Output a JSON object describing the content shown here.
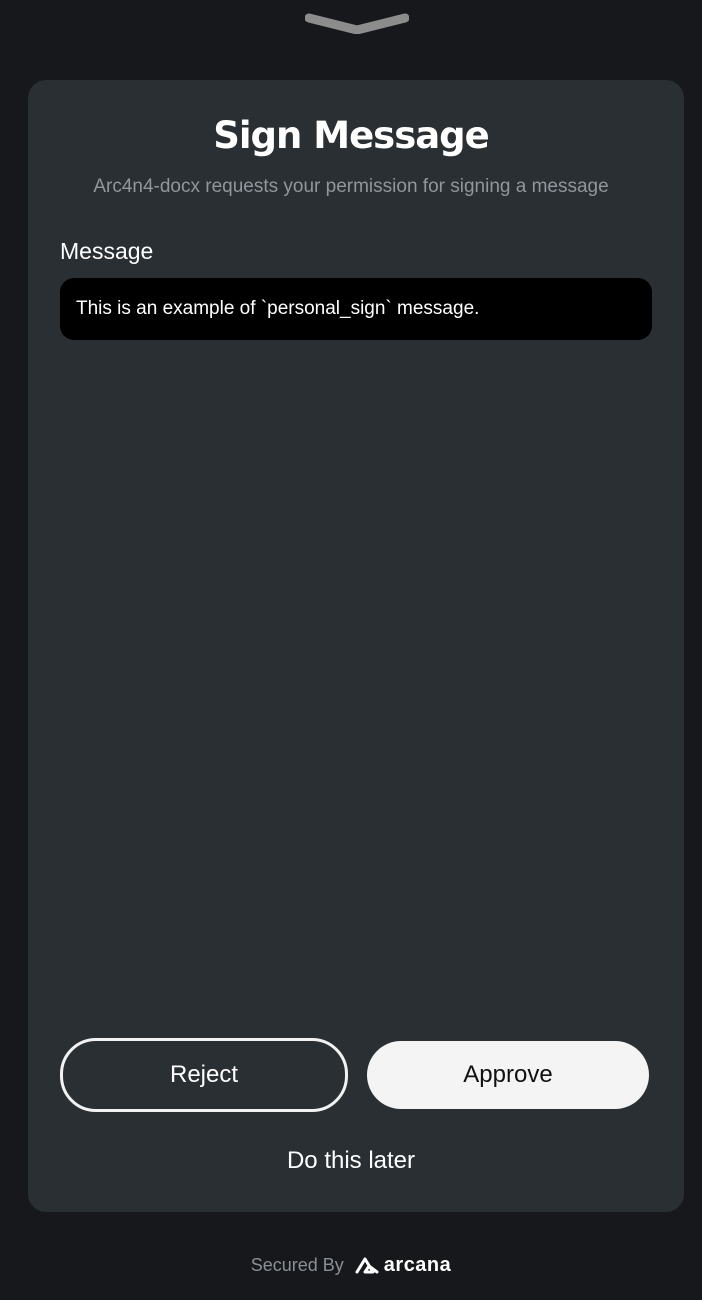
{
  "dialog": {
    "title": "Sign Message",
    "subtitle": "Arc4n4-docx requests your permission for signing a message",
    "message_label": "Message",
    "message_text": "This is an example of `personal_sign` message."
  },
  "actions": {
    "reject_label": "Reject",
    "approve_label": "Approve",
    "later_label": "Do this later"
  },
  "footer": {
    "secured_by": "Secured By",
    "brand": "arcana",
    "brand_icon": "arcana-logo-icon"
  },
  "colors": {
    "background": "#16181b",
    "card": "#2a2f33",
    "message_box": "#000000",
    "subtitle": "#8f969c",
    "approve_bg": "#f4f4f4"
  }
}
